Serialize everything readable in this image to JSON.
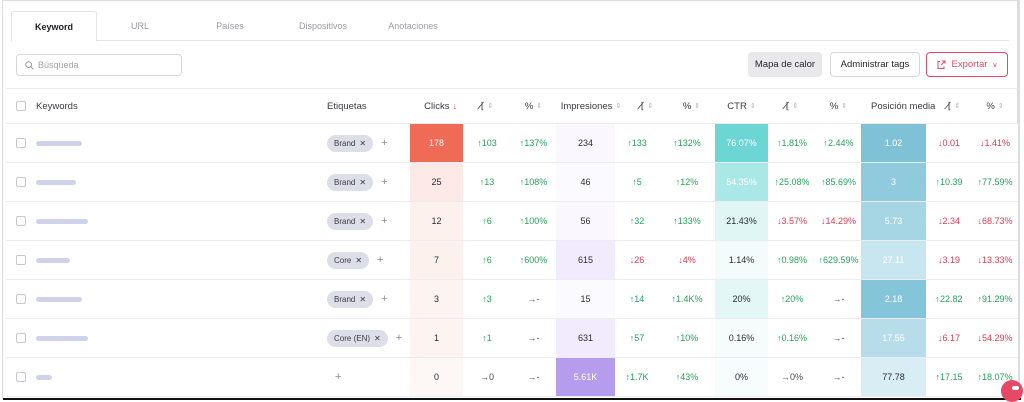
{
  "tabs": [
    {
      "label": "Keyword",
      "active": true
    },
    {
      "label": "URL",
      "active": false
    },
    {
      "label": "Países",
      "active": false
    },
    {
      "label": "Dispositivos",
      "active": false
    },
    {
      "label": "Anotaciones",
      "active": false
    }
  ],
  "search": {
    "placeholder": "Búsqueda",
    "icon": "search-icon"
  },
  "toolbar": {
    "heatmap_label": "Mapa de calor",
    "tags_label": "Administrar tags",
    "export_label": "Exportar"
  },
  "colors": {
    "accent": "#e74865",
    "up": "#27a35a",
    "down": "#e2384f",
    "clicks_max": "#ef6b55",
    "impressions_max": "#b69cec",
    "ctr_max": "#6bd6d4",
    "position_max": "#7fc2d8"
  },
  "table": {
    "headers": {
      "keywords": "Keywords",
      "labels": "Etiquetas",
      "clicks": "Clicks",
      "impressions": "Impresiones",
      "ctr": "CTR",
      "position": "Posición media",
      "pct": "%"
    },
    "rows": [
      {
        "tags": [
          "Brand"
        ],
        "clicks": "178",
        "c_delta": "↑103",
        "c_pct": "↑137%",
        "impr": "234",
        "i_delta": "↑133",
        "i_pct": "↑132%",
        "ctr": "76.07%",
        "ctr_delta": "↑1.81%",
        "ctr_pct": "↑2.44%",
        "pos": "1.02",
        "pos_delta": "↓0.01",
        "pos_pct": "↓1.41%"
      },
      {
        "tags": [
          "Brand"
        ],
        "clicks": "25",
        "c_delta": "↑13",
        "c_pct": "↑108%",
        "impr": "46",
        "i_delta": "↑5",
        "i_pct": "↑12%",
        "ctr": "54.35%",
        "ctr_delta": "↑25.08%",
        "ctr_pct": "↑85.69%",
        "pos": "3",
        "pos_delta": "↑10.39",
        "pos_pct": "↑77.59%"
      },
      {
        "tags": [
          "Brand"
        ],
        "clicks": "12",
        "c_delta": "↑6",
        "c_pct": "↑100%",
        "impr": "56",
        "i_delta": "↑32",
        "i_pct": "↑133%",
        "ctr": "21.43%",
        "ctr_delta": "↓3.57%",
        "ctr_pct": "↓14.29%",
        "pos": "5.73",
        "pos_delta": "↓2.34",
        "pos_pct": "↓68.73%"
      },
      {
        "tags": [
          "Core"
        ],
        "clicks": "7",
        "c_delta": "↑6",
        "c_pct": "↑600%",
        "impr": "615",
        "i_delta": "↓26",
        "i_pct": "↓4%",
        "ctr": "1.14%",
        "ctr_delta": "↑0.98%",
        "ctr_pct": "↑629.59%",
        "pos": "27.11",
        "pos_delta": "↓3.19",
        "pos_pct": "↓13.33%"
      },
      {
        "tags": [
          "Brand"
        ],
        "clicks": "3",
        "c_delta": "↑3",
        "c_pct": "→-",
        "impr": "15",
        "i_delta": "↑14",
        "i_pct": "↑1.4K%",
        "ctr": "20%",
        "ctr_delta": "↑20%",
        "ctr_pct": "→-",
        "pos": "2.18",
        "pos_delta": "↑22.82",
        "pos_pct": "↑91.29%"
      },
      {
        "tags": [
          "Core (EN)"
        ],
        "clicks": "1",
        "c_delta": "↑1",
        "c_pct": "→-",
        "impr": "631",
        "i_delta": "↑57",
        "i_pct": "↑10%",
        "ctr": "0.16%",
        "ctr_delta": "↑0.16%",
        "ctr_pct": "→-",
        "pos": "17.55",
        "pos_delta": "↓6.17",
        "pos_pct": "↓54.29%"
      },
      {
        "tags": [],
        "clicks": "0",
        "c_delta": "→0",
        "c_pct": "→-",
        "impr": "5.61K",
        "i_delta": "↑1.7K",
        "i_pct": "↑43%",
        "ctr": "0%",
        "ctr_delta": "→0%",
        "ctr_pct": "→-",
        "pos": "77.78",
        "pos_delta": "↑17.15",
        "pos_pct": "↑18.07%"
      }
    ]
  }
}
